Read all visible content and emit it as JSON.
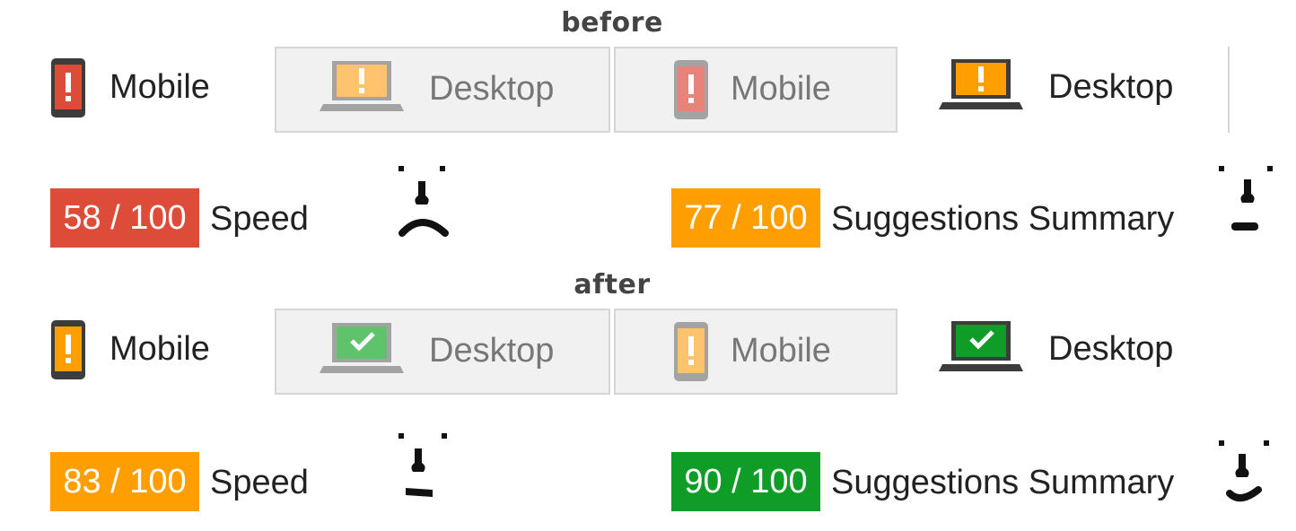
{
  "colors": {
    "red": "#dd4b39",
    "orange": "#ff9e00",
    "green": "#0f9d28",
    "light_red": "#e8837a",
    "light_orange": "#ffc36e",
    "light_green": "#5ec36a"
  },
  "before": {
    "heading": "before",
    "tabs": [
      {
        "label": "Mobile",
        "icon": "phone-warning-icon",
        "state": "active"
      },
      {
        "label": "Desktop",
        "icon": "laptop-warning-icon",
        "state": "inactive"
      },
      {
        "label": "Mobile",
        "icon": "phone-warning-icon",
        "state": "inactive"
      },
      {
        "label": "Desktop",
        "icon": "laptop-warning-icon",
        "state": "active"
      }
    ],
    "scores": [
      {
        "badge": "58 / 100",
        "label": "Speed",
        "color": "red",
        "face": "sad-face-icon"
      },
      {
        "badge": "77 / 100",
        "label": "Suggestions Summary",
        "color": "orange",
        "face": "neutral-face-icon"
      }
    ]
  },
  "after": {
    "heading": "after",
    "tabs": [
      {
        "label": "Mobile",
        "icon": "phone-warning-icon",
        "state": "active"
      },
      {
        "label": "Desktop",
        "icon": "laptop-check-icon",
        "state": "inactive"
      },
      {
        "label": "Mobile",
        "icon": "phone-warning-icon",
        "state": "inactive"
      },
      {
        "label": "Desktop",
        "icon": "laptop-check-icon",
        "state": "active"
      }
    ],
    "scores": [
      {
        "badge": "83 / 100",
        "label": "Speed",
        "color": "orange",
        "face": "neutral-face-icon"
      },
      {
        "badge": "90 / 100",
        "label": "Suggestions Summary",
        "color": "green",
        "face": "happy-face-icon"
      }
    ]
  }
}
